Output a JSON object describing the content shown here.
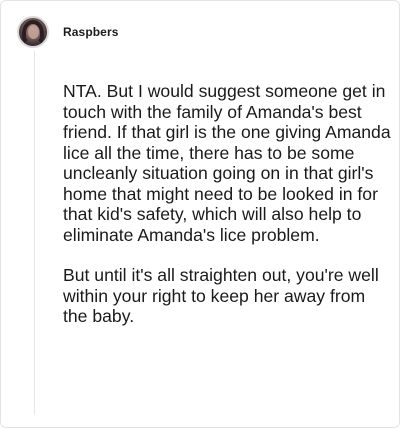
{
  "comment": {
    "author": "Raspbers",
    "paragraphs": [
      "NTA. But I would suggest someone get in touch with the family of Amanda's best friend. If that girl is the one giving Amanda lice all the time, there has to be some uncleanly situation going on in that girl's home that might need to be looked in for that kid's safety, which will also help to eliminate Amanda's lice problem.",
      "But until it's all straighten out, you're well within your right to keep her away from the baby."
    ]
  },
  "colors": {
    "text": "#1a1a1a",
    "border": "#e3e3e3",
    "background": "#ffffff"
  },
  "icons": {
    "avatar": "user-avatar-photo"
  }
}
